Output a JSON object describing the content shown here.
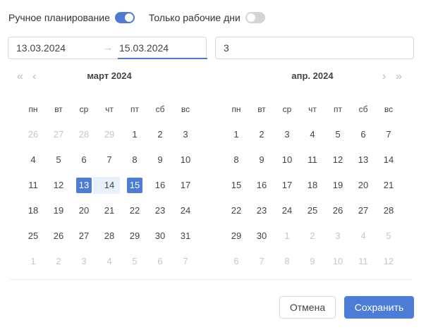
{
  "toggles": {
    "manual": {
      "label": "Ручное планирование",
      "on": true
    },
    "workdays": {
      "label": "Только рабочие дни",
      "on": false
    }
  },
  "range": {
    "start": "13.03.2024",
    "arrow": "→",
    "end": "15.03.2024"
  },
  "days_value": "3",
  "nav": {
    "super_prev": "«",
    "prev": "‹",
    "next": "›",
    "super_next": "»"
  },
  "weekdays": [
    "пн",
    "вт",
    "ср",
    "чт",
    "пт",
    "сб",
    "вс"
  ],
  "calendars": [
    {
      "title": "март  2024",
      "rows": [
        [
          "26",
          "27",
          "28",
          "29",
          "1",
          "2",
          "3"
        ],
        [
          "4",
          "5",
          "6",
          "7",
          "8",
          "9",
          "10"
        ],
        [
          "11",
          "12",
          "13",
          "14",
          "15",
          "16",
          "17"
        ],
        [
          "18",
          "19",
          "20",
          "21",
          "22",
          "23",
          "24"
        ],
        [
          "25",
          "26",
          "27",
          "28",
          "29",
          "30",
          "31"
        ],
        [
          "1",
          "2",
          "3",
          "4",
          "5",
          "6",
          "7"
        ]
      ],
      "muted": [
        [
          0,
          0
        ],
        [
          0,
          1
        ],
        [
          0,
          2
        ],
        [
          0,
          3
        ],
        [
          5,
          0
        ],
        [
          5,
          1
        ],
        [
          5,
          2
        ],
        [
          5,
          3
        ],
        [
          5,
          4
        ],
        [
          5,
          5
        ],
        [
          5,
          6
        ]
      ],
      "selected": [
        [
          2,
          2
        ],
        [
          2,
          4
        ]
      ],
      "in_range": [
        [
          2,
          3
        ]
      ]
    },
    {
      "title": "апр.  2024",
      "rows": [
        [
          "1",
          "2",
          "3",
          "4",
          "5",
          "6",
          "7"
        ],
        [
          "8",
          "9",
          "10",
          "11",
          "12",
          "13",
          "14"
        ],
        [
          "15",
          "16",
          "17",
          "18",
          "19",
          "20",
          "21"
        ],
        [
          "22",
          "23",
          "24",
          "25",
          "26",
          "27",
          "28"
        ],
        [
          "29",
          "30",
          "1",
          "2",
          "3",
          "4",
          "5"
        ],
        [
          "6",
          "7",
          "8",
          "9",
          "10",
          "11",
          "12"
        ]
      ],
      "muted": [
        [
          4,
          2
        ],
        [
          4,
          3
        ],
        [
          4,
          4
        ],
        [
          4,
          5
        ],
        [
          4,
          6
        ],
        [
          5,
          0
        ],
        [
          5,
          1
        ],
        [
          5,
          2
        ],
        [
          5,
          3
        ],
        [
          5,
          4
        ],
        [
          5,
          5
        ],
        [
          5,
          6
        ]
      ],
      "selected": [],
      "in_range": []
    }
  ],
  "buttons": {
    "cancel": "Отмена",
    "save": "Сохранить"
  },
  "colors": {
    "accent": "#4d7cd6",
    "range_bg": "#e8f0fd",
    "muted": "#c6c6c6"
  }
}
